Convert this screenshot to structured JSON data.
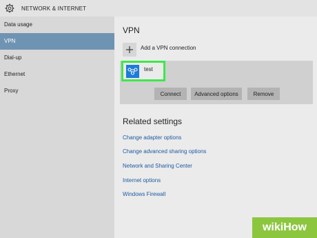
{
  "header": {
    "title": "NETWORK & INTERNET",
    "icon": "gear-icon"
  },
  "sidebar": {
    "items": [
      {
        "label": "Data usage"
      },
      {
        "label": "VPN"
      },
      {
        "label": "Dial-up"
      },
      {
        "label": "Ethernet"
      },
      {
        "label": "Proxy"
      }
    ],
    "selected": "VPN"
  },
  "main": {
    "vpn_heading": "VPN",
    "add_vpn_label": "Add a VPN connection",
    "vpn_connection": {
      "name": "test",
      "icon": "vpn-connection-icon"
    },
    "buttons": {
      "connect": "Connect",
      "advanced": "Advanced options",
      "remove": "Remove"
    },
    "related_heading": "Related settings",
    "related_links": [
      "Change adapter options",
      "Change advanced sharing options",
      "Network and Sharing Center",
      "Internet options",
      "Windows Firewall"
    ]
  },
  "watermark": {
    "text": "wikiHow"
  },
  "colors": {
    "selected_bg": "#6f93b3",
    "link": "#1d5aa0",
    "highlight": "#3ee84a",
    "vpn_icon_bg": "#1e7bd8",
    "watermark_bg": "#8cc63f"
  }
}
